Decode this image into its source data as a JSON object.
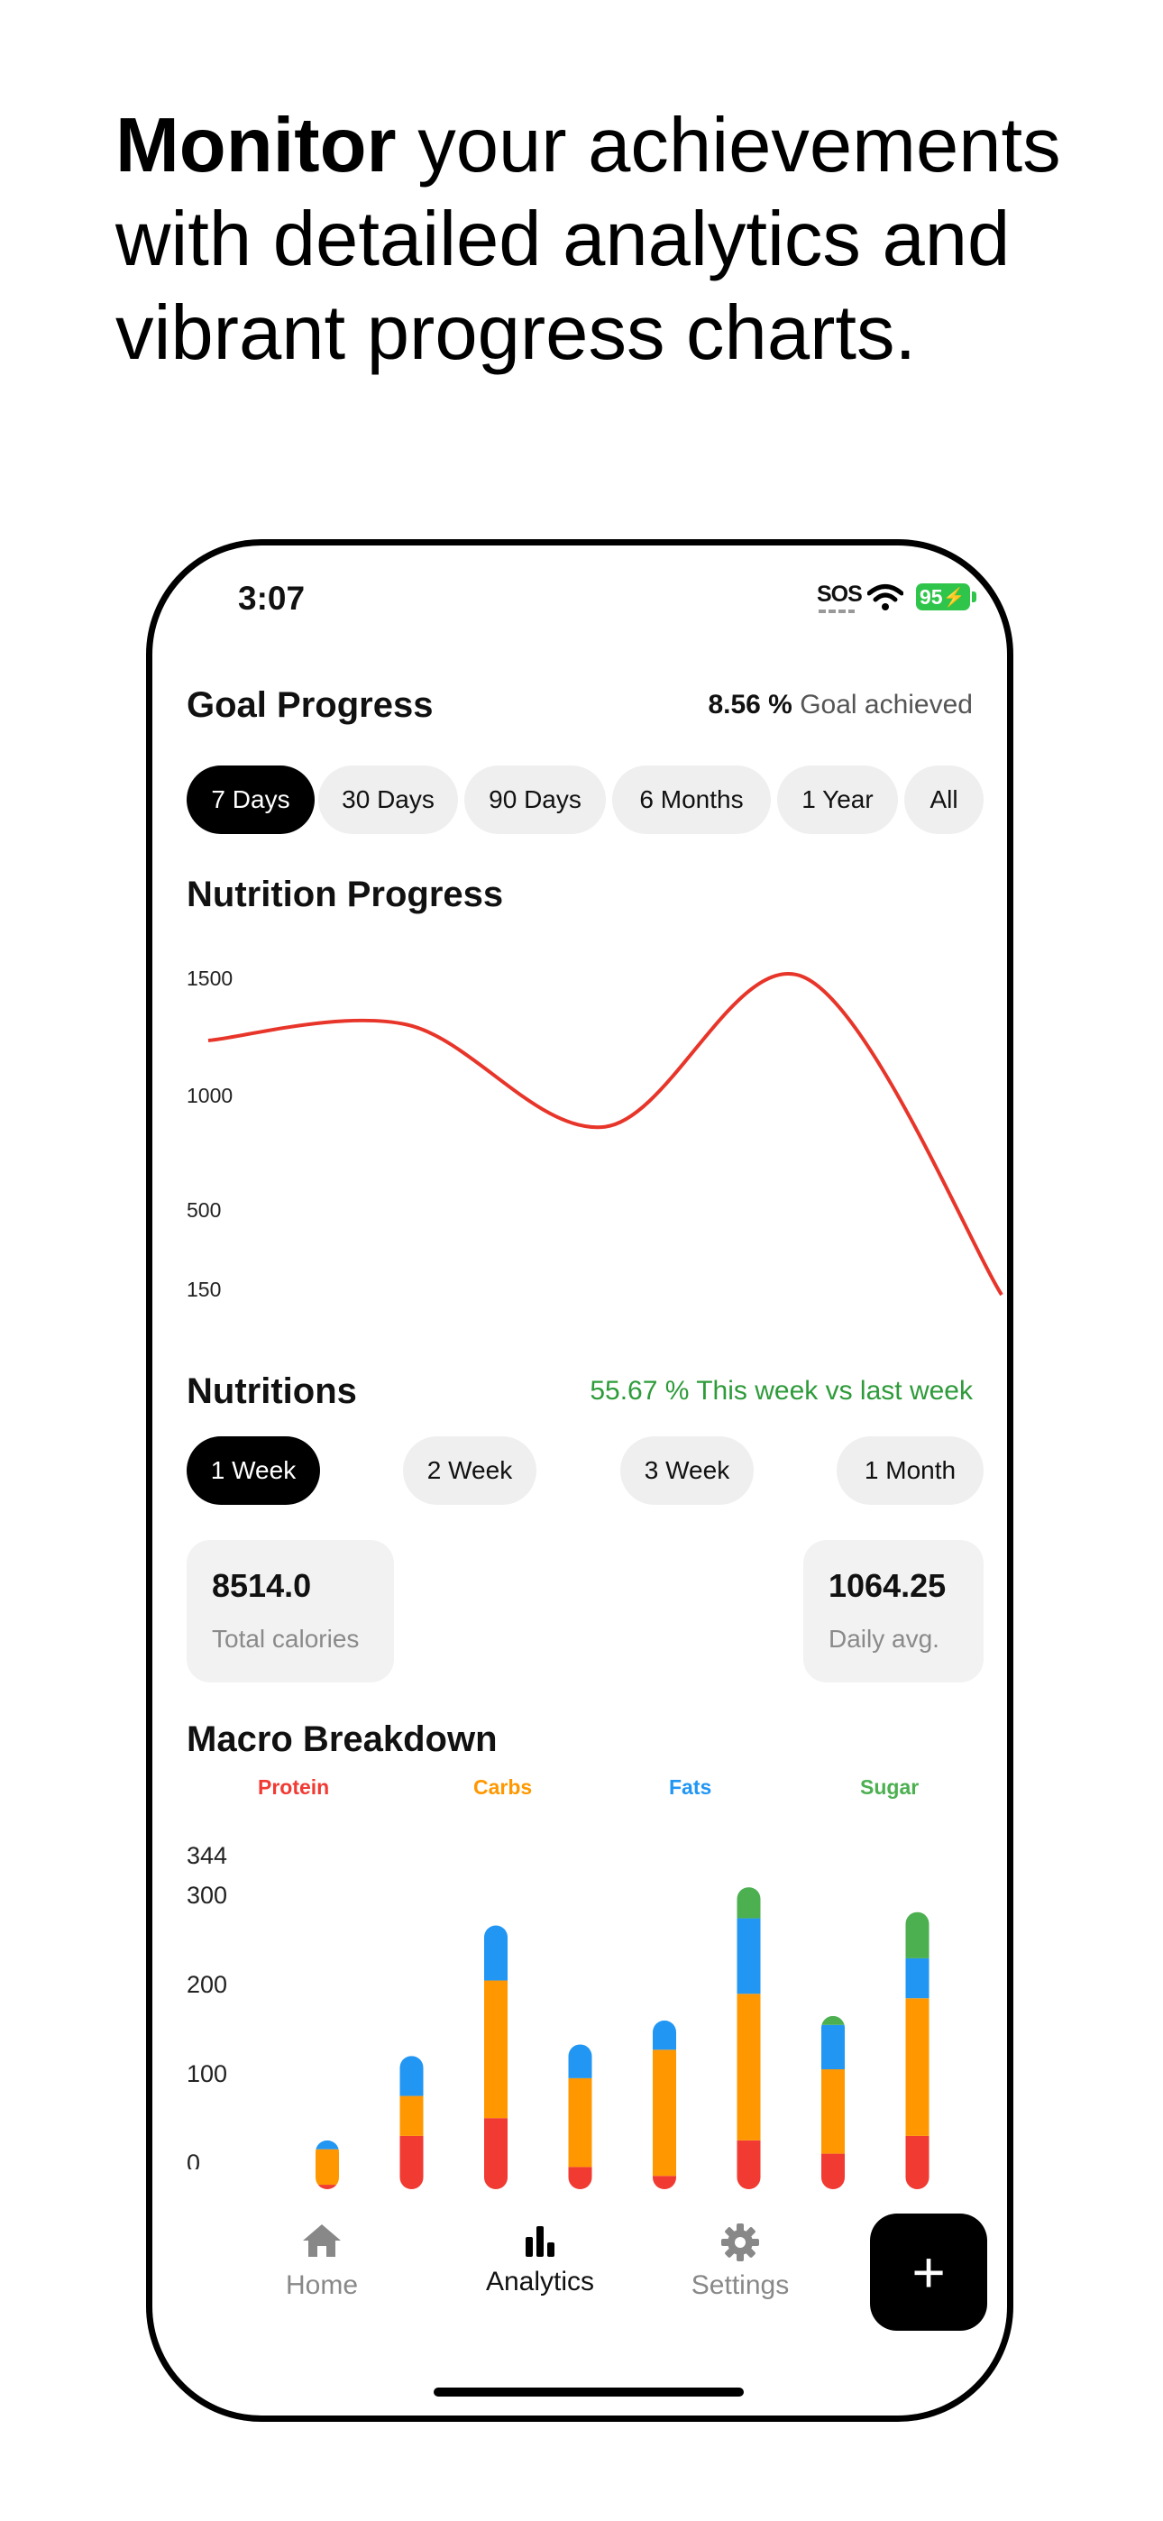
{
  "headline": {
    "bold": "Monitor",
    "rest": " your achievements with detailed analytics and vibrant progress charts."
  },
  "status": {
    "time": "3:07",
    "sos": "SOS",
    "battery": "95"
  },
  "goal": {
    "title": "Goal Progress",
    "percent": "8.56 %",
    "suffix": " Goal achieved"
  },
  "ranges": [
    "7 Days",
    "30 Days",
    "90 Days",
    "6 Months",
    "1 Year",
    "All"
  ],
  "nutrition_progress": {
    "title": "Nutrition Progress",
    "yticks": [
      "1500",
      "1000",
      "500",
      "150"
    ],
    "line_color": "#e8352a"
  },
  "nutritions": {
    "title": "Nutritions",
    "change": "55.67 % This week vs last week",
    "change_color": "#2e9b3a",
    "periods": [
      "1 Week",
      "2 Week",
      "3 Week",
      "1 Month"
    ]
  },
  "stats": {
    "total_value": "8514.0",
    "total_label": "Total calories",
    "avg_value": "1064.25",
    "avg_label": "Daily avg."
  },
  "macro": {
    "title": "Macro Breakdown",
    "legend": [
      {
        "name": "Protein",
        "color": "#f03a32"
      },
      {
        "name": "Carbs",
        "color": "#ff9800"
      },
      {
        "name": "Fats",
        "color": "#2196f3"
      },
      {
        "name": "Sugar",
        "color": "#4caf50"
      }
    ],
    "yticks": [
      "344",
      "300",
      "200",
      "100",
      "0"
    ]
  },
  "tabbar": {
    "home": "Home",
    "analytics": "Analytics",
    "settings": "Settings",
    "fab": "+"
  },
  "chart_data": [
    {
      "type": "line",
      "title": "Nutrition Progress",
      "x": [
        1,
        2,
        3,
        4,
        5,
        6
      ],
      "series": [
        {
          "values": [
            1230,
            1300,
            850,
            1510,
            110
          ]
        }
      ],
      "ylim": [
        150,
        1500
      ],
      "yticks": [
        1500,
        1000,
        500,
        150
      ]
    },
    {
      "type": "bar",
      "title": "Macro Breakdown",
      "categories": [
        "1",
        "2",
        "3",
        "4",
        "5",
        "6",
        "7",
        "8"
      ],
      "series": [
        {
          "name": "Protein",
          "values": [
            5,
            60,
            80,
            25,
            15,
            55,
            40,
            60
          ]
        },
        {
          "name": "Carbs",
          "values": [
            40,
            45,
            155,
            100,
            142,
            165,
            95,
            155
          ]
        },
        {
          "name": "Fats",
          "values": [
            10,
            45,
            62,
            38,
            33,
            85,
            50,
            45
          ]
        },
        {
          "name": "Sugar",
          "values": [
            0,
            0,
            0,
            0,
            0,
            35,
            10,
            52
          ]
        }
      ],
      "ylim": [
        0,
        344
      ],
      "yticks": [
        344,
        300,
        200,
        100,
        0
      ]
    }
  ]
}
